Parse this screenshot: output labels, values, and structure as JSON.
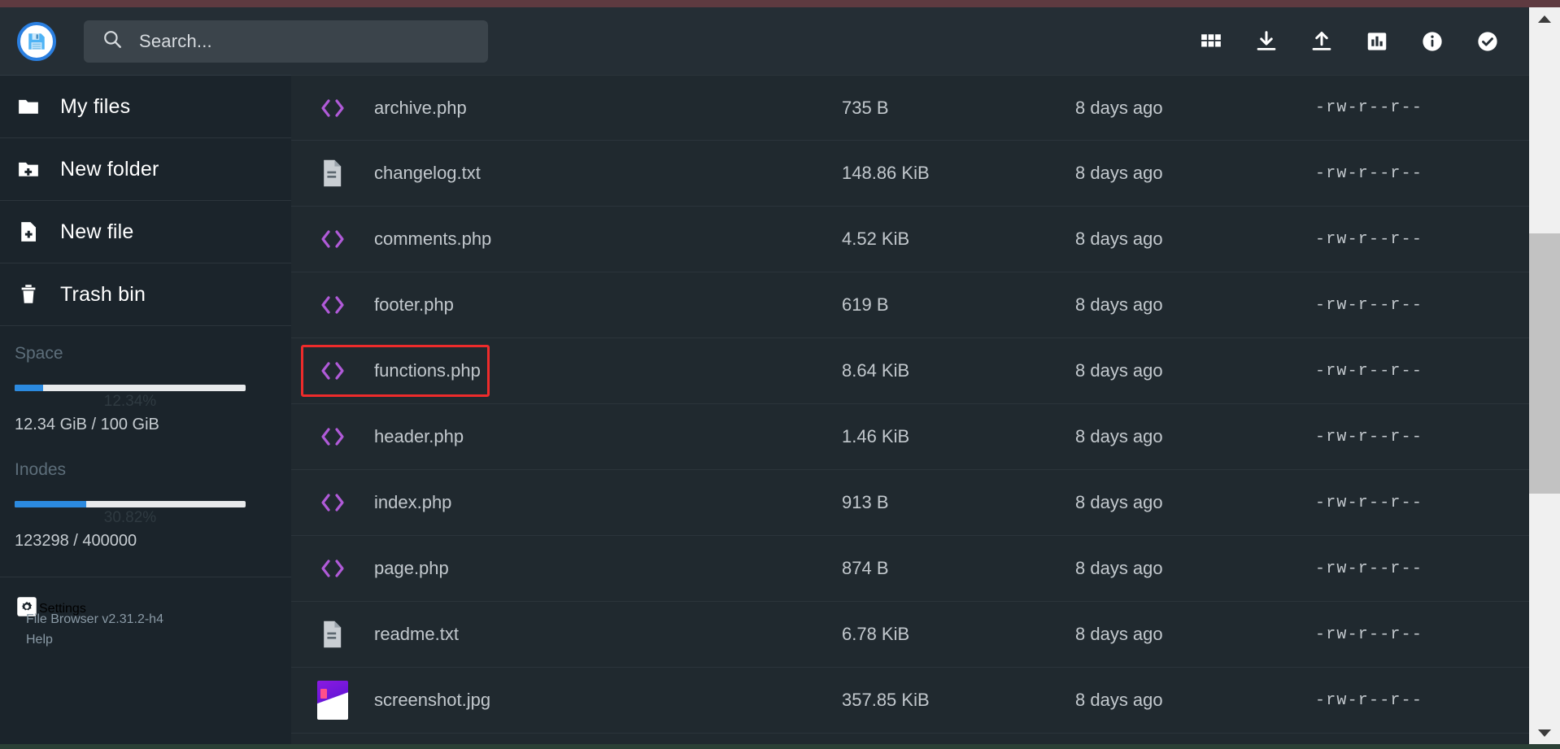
{
  "app": {
    "logo_icon": "floppy-disk-icon",
    "version": "File Browser v2.31.2-h4",
    "help_label": "Help"
  },
  "search": {
    "placeholder": "Search...",
    "value": "",
    "icon": "search-icon"
  },
  "header": {
    "actions": [
      {
        "name": "grid-view-icon",
        "label": "Switch view"
      },
      {
        "name": "download-icon",
        "label": "Download"
      },
      {
        "name": "upload-icon",
        "label": "Upload"
      },
      {
        "name": "chart-icon",
        "label": "Usage"
      },
      {
        "name": "info-icon",
        "label": "Info"
      },
      {
        "name": "check-circle-icon",
        "label": "Select"
      }
    ]
  },
  "sidebar": {
    "items": [
      {
        "label": "My files",
        "icon": "folder-icon"
      },
      {
        "label": "New folder",
        "icon": "folder-plus-icon"
      },
      {
        "label": "New file",
        "icon": "file-plus-icon"
      },
      {
        "label": "Trash bin",
        "icon": "trash-icon"
      }
    ],
    "usage": [
      {
        "title": "Space",
        "percent": 12.34,
        "percent_label": "12.34%",
        "text": "12.34 GiB / 100 GiB"
      },
      {
        "title": "Inodes",
        "percent": 30.82,
        "percent_label": "30.82%",
        "text": "123298 / 400000"
      }
    ],
    "settings": {
      "label": "Settings",
      "icon": "gear-icon"
    }
  },
  "colors": {
    "accent_blue": "#2b8ae0",
    "selection_red": "#ee2b2b",
    "code_icon_purple": "#b05ad8",
    "sidebar_bg": "#1b242b",
    "main_bg": "#20292f",
    "header_bg": "#252e35"
  },
  "filelist": {
    "rows": [
      {
        "name": "archive.php",
        "size": "735 B",
        "date": "8 days ago",
        "perm": "-rw-r--r--",
        "icon": "code-file-icon",
        "selected": false
      },
      {
        "name": "changelog.txt",
        "size": "148.86 KiB",
        "date": "8 days ago",
        "perm": "-rw-r--r--",
        "icon": "text-file-icon",
        "selected": false
      },
      {
        "name": "comments.php",
        "size": "4.52 KiB",
        "date": "8 days ago",
        "perm": "-rw-r--r--",
        "icon": "code-file-icon",
        "selected": false
      },
      {
        "name": "footer.php",
        "size": "619 B",
        "date": "8 days ago",
        "perm": "-rw-r--r--",
        "icon": "code-file-icon",
        "selected": false
      },
      {
        "name": "functions.php",
        "size": "8.64 KiB",
        "date": "8 days ago",
        "perm": "-rw-r--r--",
        "icon": "code-file-icon",
        "selected": true
      },
      {
        "name": "header.php",
        "size": "1.46 KiB",
        "date": "8 days ago",
        "perm": "-rw-r--r--",
        "icon": "code-file-icon",
        "selected": false
      },
      {
        "name": "index.php",
        "size": "913 B",
        "date": "8 days ago",
        "perm": "-rw-r--r--",
        "icon": "code-file-icon",
        "selected": false
      },
      {
        "name": "page.php",
        "size": "874 B",
        "date": "8 days ago",
        "perm": "-rw-r--r--",
        "icon": "code-file-icon",
        "selected": false
      },
      {
        "name": "readme.txt",
        "size": "6.78 KiB",
        "date": "8 days ago",
        "perm": "-rw-r--r--",
        "icon": "text-file-icon",
        "selected": false
      },
      {
        "name": "screenshot.jpg",
        "size": "357.85 KiB",
        "date": "8 days ago",
        "perm": "-rw-r--r--",
        "icon": "image-thumbnail",
        "selected": false
      }
    ]
  }
}
